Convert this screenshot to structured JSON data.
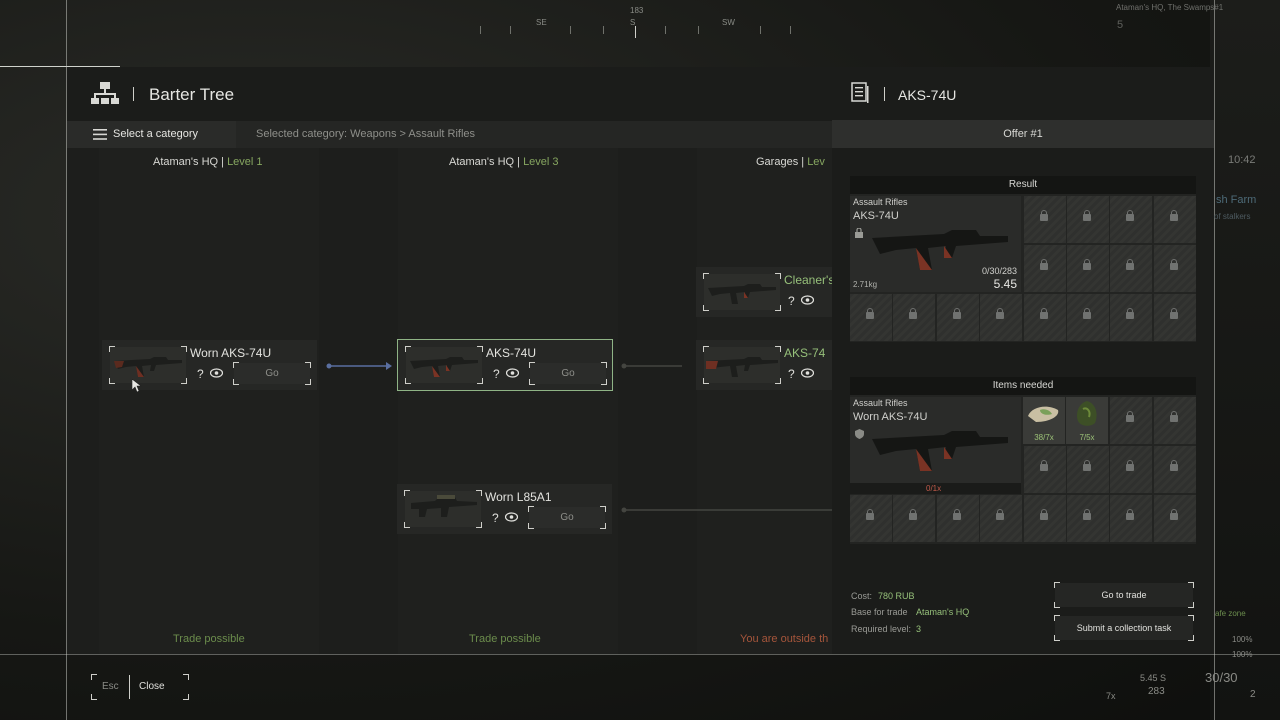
{
  "hud": {
    "compass": {
      "heading": "183",
      "markers": [
        "SE",
        "S",
        "SW"
      ]
    },
    "location": "Ataman's HQ, The Swamps#1",
    "location_num": "5",
    "clock": "10:42",
    "zone_name": "sh Farm",
    "zone_sub": "of stalkers",
    "safe_zone": "afe zone",
    "pct1": "100%",
    "pct2": "100%",
    "ammo_cal": "5.45 S",
    "ammo_count": "283",
    "ammo_mag": "30/30",
    "item_count": "7x",
    "grenades": "2"
  },
  "panel": {
    "title": "Barter Tree",
    "category_button": "Select a category",
    "selected_category": "Selected category: Weapons > Assault Rifles",
    "columns": [
      {
        "place": "Ataman's HQ",
        "level": "Level 1",
        "status": "Trade possible"
      },
      {
        "place": "Ataman's HQ",
        "level": "Level 3",
        "status": "Trade possible"
      },
      {
        "place": "Garages",
        "level": "Lev",
        "status": "You are outside th"
      }
    ],
    "cards": [
      {
        "name": "Worn AKS-74U",
        "q": "?",
        "go": "Go"
      },
      {
        "name": "AKS-74U",
        "q": "?",
        "go": "Go"
      },
      {
        "name": "Worn L85A1",
        "q": "?",
        "go": "Go"
      },
      {
        "name": "Cleaner's",
        "q": "?"
      },
      {
        "name": "AKS-74",
        "q": "?"
      }
    ]
  },
  "detail": {
    "title": "AKS-74U",
    "offer": "Offer #1",
    "result_label": "Result",
    "result": {
      "category": "Assault Rifles",
      "name": "AKS-74U",
      "weight": "2.71kg",
      "ammo": "0/30/283",
      "caliber": "5.45"
    },
    "needed_label": "Items needed",
    "needed": {
      "category": "Assault Rifles",
      "name": "Worn AKS-74U",
      "count": "0/1x"
    },
    "extra_items": [
      {
        "count": "38/7x"
      },
      {
        "count": "7/5x"
      }
    ],
    "cost_label": "Cost:",
    "cost_value": "780 RUB",
    "base_label": "Base for trade",
    "base_value": "Ataman's HQ",
    "level_label": "Required level:",
    "level_value": "3",
    "go_trade": "Go to trade",
    "submit_task": "Submit a collection task"
  },
  "footer": {
    "esc_key": "Esc",
    "close": "Close"
  },
  "colors": {
    "accent_green": "#86a660",
    "select_border": "#8fb486"
  }
}
